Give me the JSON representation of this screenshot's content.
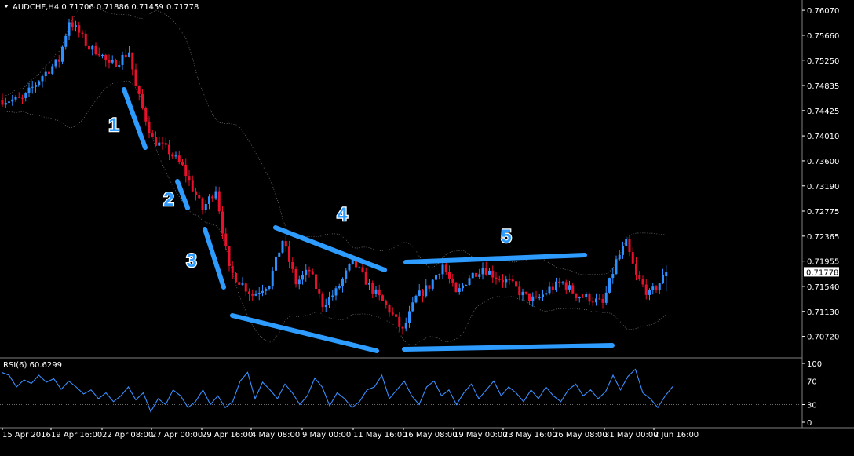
{
  "chart_header": {
    "symbol_info": "AUDCHF,H4  0.71706 0.71886 0.71459 0.71778",
    "indicator_info": "RSI(6) 60.6299"
  },
  "colors": {
    "background": "#000000",
    "bull_candle": "#2e8fff",
    "bear_candle": "#e8102a",
    "trendline": "#2e9bff",
    "band": "#707070",
    "rsi_line": "#3a8fff",
    "text": "#ffffff",
    "grid": "#808080"
  },
  "annotations": [
    "1",
    "2",
    "3",
    "4",
    "5"
  ],
  "chart_data": [
    {
      "type": "candlestick",
      "title": "AUDCHF,H4  0.71706 0.71886 0.71459 0.71778",
      "current_price": "0.71778",
      "ylim": [
        0.7038,
        0.762
      ],
      "y_ticks": [
        "0.76070",
        "0.75660",
        "0.75250",
        "0.74835",
        "0.74425",
        "0.74010",
        "0.73600",
        "0.73190",
        "0.72775",
        "0.72365",
        "0.71955",
        "0.71540",
        "0.71130",
        "0.70720"
      ],
      "x_ticks": [
        "15 Apr 2016",
        "19 Apr 16:00",
        "22 Apr 08:00",
        "27 Apr 00:00",
        "29 Apr 16:00",
        "4 May 08:00",
        "9 May 00:00",
        "11 May 16:00",
        "16 May 08:00",
        "19 May 00:00",
        "23 May 16:00",
        "26 May 08:00",
        "31 May 00:00",
        "2 Jun 16:00"
      ],
      "path_points": [
        [
          0,
          0.746
        ],
        [
          6,
          0.746
        ],
        [
          12,
          0.75
        ],
        [
          17,
          0.7525
        ],
        [
          20,
          0.759
        ],
        [
          23,
          0.757
        ],
        [
          26,
          0.7545
        ],
        [
          29,
          0.754
        ],
        [
          32,
          0.7515
        ],
        [
          35,
          0.7525
        ],
        [
          38,
          0.754
        ],
        [
          40,
          0.748
        ],
        [
          45,
          0.7395
        ],
        [
          50,
          0.7375
        ],
        [
          54,
          0.735
        ],
        [
          60,
          0.728
        ],
        [
          64,
          0.7315
        ],
        [
          68,
          0.718
        ],
        [
          75,
          0.714
        ],
        [
          80,
          0.716
        ],
        [
          84,
          0.723
        ],
        [
          88,
          0.716
        ],
        [
          92,
          0.718
        ],
        [
          96,
          0.7125
        ],
        [
          100,
          0.7145
        ],
        [
          105,
          0.7195
        ],
        [
          110,
          0.7155
        ],
        [
          116,
          0.7115
        ],
        [
          120,
          0.708
        ],
        [
          124,
          0.7135
        ],
        [
          128,
          0.7155
        ],
        [
          132,
          0.719
        ],
        [
          136,
          0.714
        ],
        [
          140,
          0.717
        ],
        [
          144,
          0.7185
        ],
        [
          148,
          0.717
        ],
        [
          152,
          0.716
        ],
        [
          156,
          0.714
        ],
        [
          160,
          0.713
        ],
        [
          164,
          0.715
        ],
        [
          168,
          0.716
        ],
        [
          172,
          0.714
        ],
        [
          176,
          0.7135
        ],
        [
          180,
          0.7125
        ],
        [
          184,
          0.7195
        ],
        [
          187,
          0.7225
        ],
        [
          190,
          0.717
        ],
        [
          194,
          0.714
        ],
        [
          197,
          0.716
        ],
        [
          199,
          0.71778
        ]
      ],
      "bands_visible": true
    },
    {
      "type": "line",
      "title": "RSI(6) 60.6299",
      "ylim": [
        0,
        100
      ],
      "y_ticks": [
        "100",
        "70",
        "30",
        "0"
      ],
      "levels": [
        70,
        30
      ],
      "values": [
        85,
        80,
        60,
        72,
        66,
        80,
        68,
        74,
        56,
        70,
        60,
        48,
        55,
        40,
        50,
        35,
        45,
        60,
        38,
        50,
        18,
        40,
        30,
        55,
        45,
        25,
        35,
        55,
        30,
        45,
        25,
        35,
        70,
        85,
        40,
        68,
        55,
        40,
        65,
        50,
        30,
        45,
        75,
        60,
        28,
        50,
        40,
        25,
        35,
        55,
        60,
        80,
        40,
        55,
        70,
        45,
        30,
        60,
        70,
        45,
        55,
        30,
        50,
        65,
        40,
        55,
        70,
        45,
        60,
        50,
        35,
        55,
        40,
        60,
        45,
        35,
        55,
        65,
        45,
        55,
        40,
        52,
        80,
        55,
        78,
        90,
        50,
        40,
        25,
        45,
        60.63
      ]
    }
  ]
}
